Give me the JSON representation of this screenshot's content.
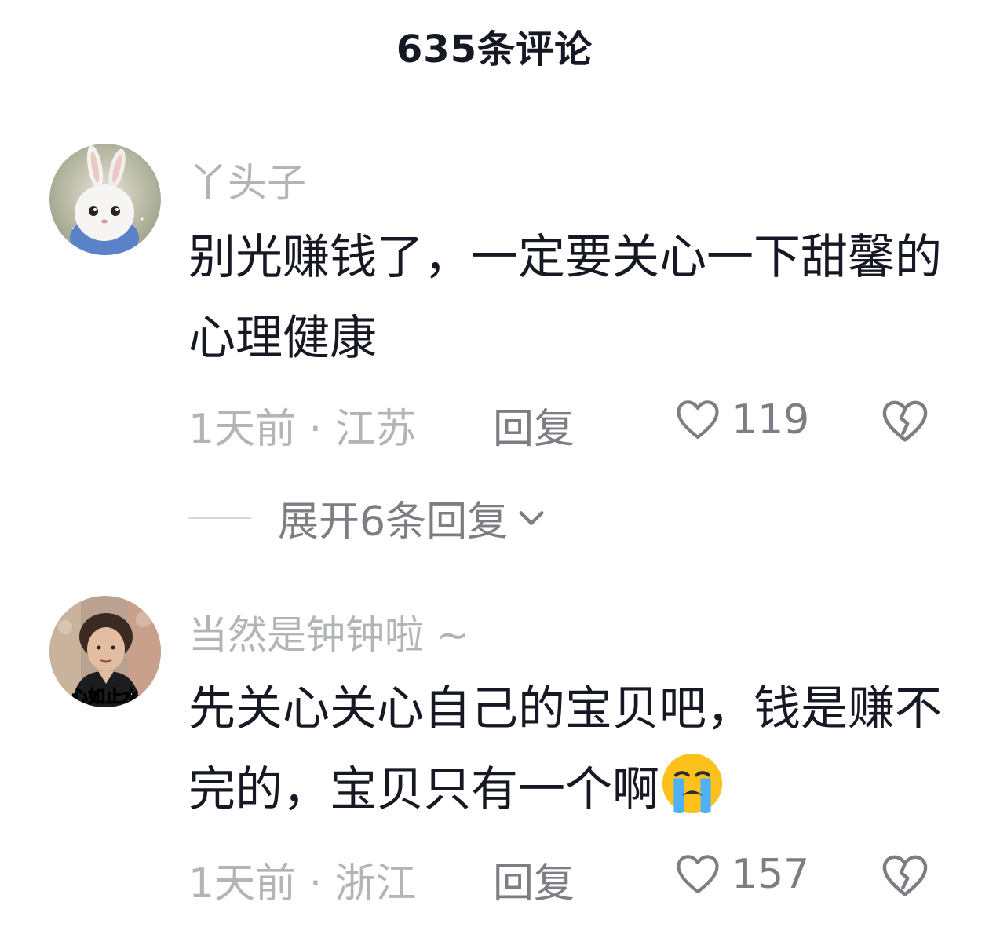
{
  "header": {
    "title": "635条评论"
  },
  "comments": [
    {
      "username": "丫头子",
      "text": "别光赚钱了，一定要关心一下甜馨的心理健康",
      "time_location": "1天前 · 江苏",
      "reply_label": "回复",
      "likes": "119",
      "expand_label": "展开6条回复"
    },
    {
      "username": "当然是钟钟啦 ~",
      "text": "先关心关心自己的宝贝吧，钱是赚不完的，宝贝只有一个啊",
      "avatar_caption": "心如止水",
      "time_location": "1天前 · 浙江",
      "reply_label": "回复",
      "likes": "157"
    }
  ],
  "icons": {
    "like": "heart-outline-icon",
    "dislike": "broken-heart-icon",
    "expand": "chevron-down-icon",
    "emoji": "loudly-crying-face-emoji"
  },
  "colors": {
    "text_primary": "#161823",
    "text_secondary": "#7d7e83",
    "text_tertiary": "#b3b4b8",
    "background": "#ffffff"
  }
}
